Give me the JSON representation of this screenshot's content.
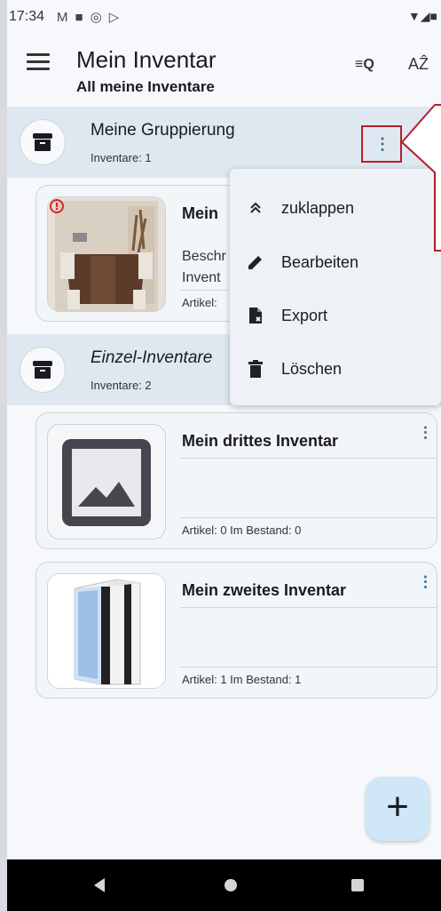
{
  "status": {
    "time": "17:34",
    "icons": [
      "M",
      "■",
      "◎",
      "▷"
    ],
    "right": "▼◢■"
  },
  "appbar": {
    "title": "Mein Inventar",
    "subtitle": "All meine Inventare",
    "search_icon": "≡Q",
    "sort_icon": "AẐ"
  },
  "groups": [
    {
      "title": "Meine Gruppierung",
      "count": "Inventare: 1",
      "more": "⋮"
    },
    {
      "title": "Einzel-Inventare",
      "count": "Inventare: 2"
    }
  ],
  "cards": [
    {
      "title": "Mein",
      "desc_line1": "Beschr",
      "desc_line2": "Invent",
      "stats": "Artikel:"
    },
    {
      "title": "Mein drittes Inventar",
      "stats": "Artikel: 0   Im Bestand: 0",
      "more": "⋮"
    },
    {
      "title": "Mein zweites Inventar",
      "stats": "Artikel: 1   Im Bestand: 1",
      "more": "⋮"
    }
  ],
  "popup_menu": [
    {
      "label": "zuklappen",
      "icon": "collapse-icon"
    },
    {
      "label": "Bearbeiten",
      "icon": "pencil-icon"
    },
    {
      "label": "Export",
      "icon": "export-icon"
    },
    {
      "label": "Löschen",
      "icon": "trash-icon"
    }
  ],
  "fab": {
    "symbol": "+"
  },
  "colors": {
    "accent": "#2a6b8a",
    "group_bg": "#dfe8f1",
    "fab_bg": "#cfe7f7",
    "highlight": "#b51f2b"
  }
}
